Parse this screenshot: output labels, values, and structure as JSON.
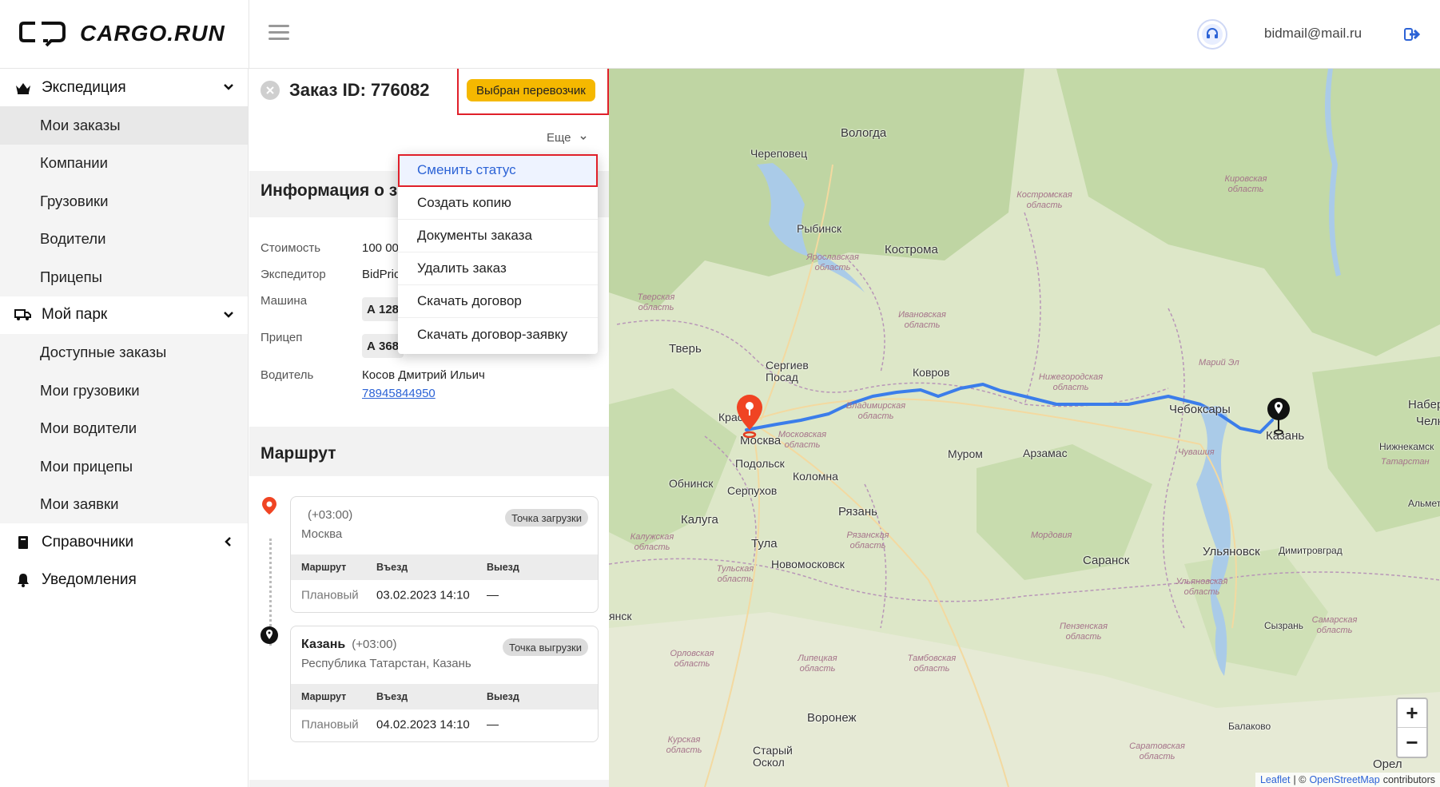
{
  "header": {
    "brand": "CARGO.RUN",
    "user_email": "bidmail@mail.ru"
  },
  "sidebar": {
    "groups": [
      {
        "label": "Экспедиция",
        "icon": "crown-icon",
        "items": [
          "Мои заказы",
          "Компании",
          "Грузовики",
          "Водители",
          "Прицепы"
        ]
      },
      {
        "label": "Мой парк",
        "icon": "truck-icon",
        "items": [
          "Доступные заказы",
          "Мои грузовики",
          "Мои водители",
          "Мои прицепы",
          "Мои заявки"
        ]
      },
      {
        "label": "Справочники",
        "icon": "book-icon"
      },
      {
        "label": "Уведомления",
        "icon": "bell-icon"
      }
    ],
    "active_item": "Мои заказы"
  },
  "order": {
    "title": "Заказ ID: 776082",
    "status": "Выбран перевозчик",
    "more_label": "Еще",
    "info_title": "Информация о з",
    "info": {
      "cost_label": "Стоимость",
      "cost_value": "100 00",
      "forwarder_label": "Экспедитор",
      "forwarder_value": "BidPric",
      "vehicle_label": "Машина",
      "vehicle_value": "А 128",
      "trailer_label": "Прицеп",
      "trailer_value": "А 368",
      "driver_label": "Водитель",
      "driver_name": "Косов Дмитрий Ильич",
      "driver_phone": "78945844950"
    },
    "route_title": "Маршрут",
    "stops": [
      {
        "city": "",
        "tz": "(+03:00)",
        "region": "Москва",
        "tag": "Точка загрузки",
        "col_route": "Маршрут",
        "col_in": "Въезд",
        "col_out": "Выезд",
        "row_type": "Плановый",
        "row_in": "03.02.2023 14:10",
        "row_out": "—"
      },
      {
        "city": "Казань",
        "tz": "(+03:00)",
        "region": "Республика Татарстан, Казань",
        "tag": "Точка выгрузки",
        "col_route": "Маршрут",
        "col_in": "Въезд",
        "col_out": "Выезд",
        "row_type": "Плановый",
        "row_in": "04.02.2023 14:10",
        "row_out": "—"
      }
    ]
  },
  "dropdown": {
    "items": [
      "Сменить статус",
      "Создать копию",
      "Документы заказа",
      "Удалить заказ",
      "Скачать договор",
      "Скачать договор-заявку"
    ]
  },
  "map": {
    "cities": [
      "Вологда",
      "Череповец",
      "Рыбинск",
      "Кострома",
      "Тверь",
      "Сергиев Посад",
      "Ковров",
      "Красно",
      "Москва",
      "Подольск",
      "Обнинск",
      "Серпухов",
      "Коломна",
      "Муром",
      "Арзамас",
      "Чебоксары",
      "Казань",
      "Набере",
      "Челн",
      "Нижнекамск",
      "Альметь",
      "Калуга",
      "Тула",
      "Рязань",
      "Новомосковск",
      "Саранск",
      "Ульяновск",
      "Димитровград",
      "Сызрань",
      "Балаково",
      "Воронеж",
      "Старый Оскол",
      "Орел",
      "янск"
    ],
    "regions": [
      "Костромская область",
      "Ярославская область",
      "Тверская область",
      "Ивановская область",
      "Нижегородская область",
      "Владимирская область",
      "Московская область",
      "Чувашия",
      "Марий Эл",
      "Кировская область",
      "Татарстан",
      "Калужская область",
      "Рязанская область",
      "Тульская область",
      "Мордовия",
      "Ульяновская область",
      "Пензенская область",
      "Самарская область",
      "Орловская область",
      "Липецкая область",
      "Тамбовская область",
      "Курская область",
      "Саратовская область"
    ],
    "zoom_in": "+",
    "zoom_out": "−",
    "attribution_leaflet": "Leaflet",
    "attribution_sep": "| ©",
    "attribution_osm": "OpenStreetMap",
    "attribution_tail": "contributors",
    "route_color": "#3b7dea"
  }
}
